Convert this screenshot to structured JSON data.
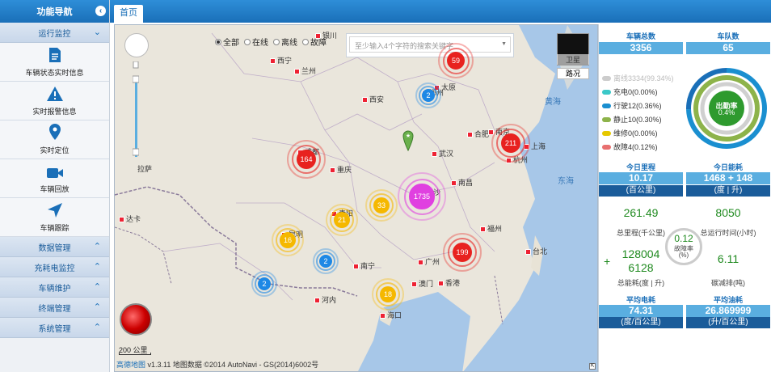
{
  "sidebar": {
    "title": "功能导航",
    "collapse_icon": "chevron-left-icon",
    "groups": [
      {
        "label": "运行监控",
        "expanded": true
      },
      {
        "label": "数据管理"
      },
      {
        "label": "充耗电监控"
      },
      {
        "label": "车辆维护"
      },
      {
        "label": "终端管理"
      },
      {
        "label": "系统管理"
      }
    ],
    "items": [
      {
        "label": "车辆状态实时信息",
        "icon": "document-icon"
      },
      {
        "label": "实时报警信息",
        "icon": "warning-icon"
      },
      {
        "label": "实时定位",
        "icon": "location-pin-icon"
      },
      {
        "label": "车辆回放",
        "icon": "video-camera-icon"
      },
      {
        "label": "车辆跟踪",
        "icon": "navigation-arrow-icon"
      }
    ]
  },
  "tabs": [
    {
      "label": "首页",
      "active": true
    }
  ],
  "map": {
    "filter": [
      {
        "label": "全部",
        "selected": true
      },
      {
        "label": "在线",
        "selected": false
      },
      {
        "label": "离线",
        "selected": false
      },
      {
        "label": "故障",
        "selected": false
      }
    ],
    "search_placeholder": "至少输入4个字符的搜索关键字",
    "satellite_label": "卫星",
    "road_label": "路况",
    "scale_label": "200 公里",
    "attribution_logo": "高德地图",
    "attribution_text": "v1.3.11 地图数据 ©2014 AutoNavi - GS(2014)6002号",
    "cities": [
      "银川",
      "西宁",
      "兰州",
      "太原",
      "郑州",
      "西安",
      "合肥",
      "南京",
      "上海",
      "武汉",
      "杭州",
      "成都",
      "重庆",
      "长沙",
      "南昌",
      "贵阳",
      "昆明",
      "福州",
      "南宁",
      "广州",
      "澳门",
      "香港",
      "海口",
      "台北",
      "河内",
      "拉萨",
      "萨",
      "达卡"
    ],
    "seas": [
      "黄海",
      "东海"
    ],
    "clusters": [
      {
        "count": "59",
        "color": "#e8221f"
      },
      {
        "count": "2",
        "color": "#1e88e5"
      },
      {
        "count": "164",
        "color": "#e8221f"
      },
      {
        "count": "211",
        "color": "#e8221f"
      },
      {
        "count": "1735",
        "color": "#e040e0"
      },
      {
        "count": "33",
        "color": "#f5b800"
      },
      {
        "count": "21",
        "color": "#f5b800"
      },
      {
        "count": "16",
        "color": "#f5b800"
      },
      {
        "count": "2",
        "color": "#1e88e5"
      },
      {
        "count": "2",
        "color": "#1e88e5"
      },
      {
        "count": "199",
        "color": "#e8221f"
      },
      {
        "count": "18",
        "color": "#f5b800"
      }
    ]
  },
  "stats": {
    "vehicle_total_label": "车辆总数",
    "vehicle_total": "3356",
    "fleet_count_label": "车队数",
    "fleet_count": "65",
    "legend": [
      {
        "label": "离线3334(99.34%)",
        "color": "#cccccc"
      },
      {
        "label": "充电0(0.00%)",
        "color": "#3bc8c8"
      },
      {
        "label": "行驶12(0.36%)",
        "color": "#1a8fd0"
      },
      {
        "label": "静止10(0.30%)",
        "color": "#8db34a"
      },
      {
        "label": "维修0(0.00%)",
        "color": "#e6c800"
      },
      {
        "label": "故障4(0.12%)",
        "color": "#e87070"
      }
    ],
    "attendance_label": "出勤率",
    "attendance_value": "0.4%",
    "attendance_fraction": 0.004,
    "today_mileage_label": "今日里程",
    "today_mileage": "10.17",
    "today_mileage_unit": "(百公里)",
    "today_energy_label": "今日能耗",
    "today_energy": "1468 + 148",
    "today_energy_unit": "(度 | 升)",
    "total_mileage": "261.49",
    "total_mileage_label": "总里程(千公里)",
    "total_runtime": "8050",
    "total_runtime_label": "总运行时间(小时)",
    "fault_rate": "0.12",
    "fault_rate_label": "故障率",
    "fault_rate_unit": "(%)",
    "total_energy_plus": "+",
    "total_energy_a": "128004",
    "total_energy_b": "6128",
    "total_energy_label": "总能耗(度 | 升)",
    "carbon": "6.11",
    "carbon_label": "碳减排(吨)",
    "avg_power_label": "平均电耗",
    "avg_power": "74.31",
    "avg_power_unit": "(度/百公里)",
    "avg_fuel_label": "平均油耗",
    "avg_fuel": "26.869999",
    "avg_fuel_unit": "(升/百公里)"
  }
}
